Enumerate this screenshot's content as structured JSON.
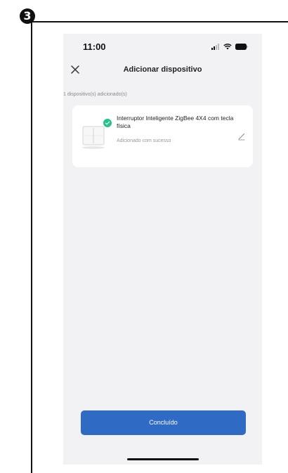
{
  "step": {
    "number": "3"
  },
  "status_bar": {
    "time": "11:00"
  },
  "header": {
    "title": "Adicionar dispositivo",
    "close_icon": "close-icon"
  },
  "main": {
    "added_count_text": "1 dispositivo(s) adicionado(s)",
    "device": {
      "name": "Interruptor Inteligente ZigBee 4X4 com tecla física",
      "status": "Adicionado com sucesso",
      "status_icon": "check-icon",
      "edit_icon": "edit-icon"
    }
  },
  "footer": {
    "done_label": "Concluído"
  },
  "colors": {
    "accent": "#2f6bc4",
    "success": "#22c48a",
    "background": "#f2f2f4"
  }
}
